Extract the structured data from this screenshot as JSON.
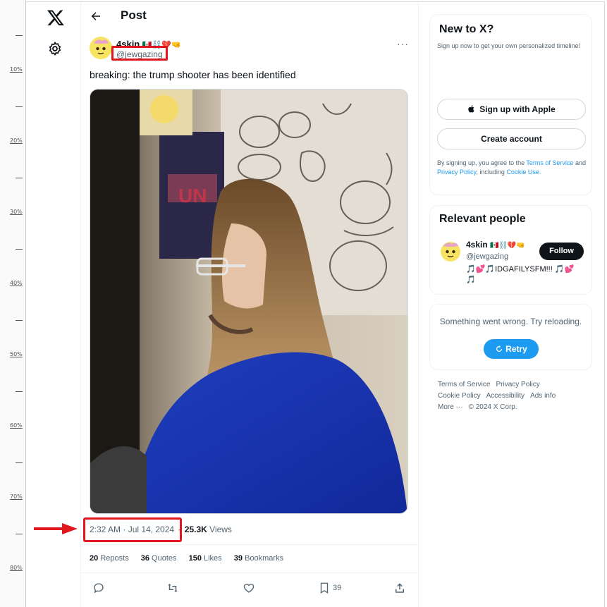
{
  "ruler": {
    "labels": [
      "10%",
      "20%",
      "30%",
      "40%",
      "50%",
      "60%",
      "70%",
      "80%"
    ]
  },
  "nav": {
    "logo_icon": "x-logo-icon",
    "settings_icon": "gear-icon"
  },
  "header": {
    "title": "Post",
    "back_icon": "arrow-left-icon"
  },
  "post": {
    "author_name": "4skin",
    "author_emojis": "🇲🇽⛓️💔🤜",
    "handle": "@jewgazing",
    "text": "breaking: the trump shooter has been identified",
    "timestamp": "2:32 AM · Jul 14, 2024",
    "views_count": "25.3K",
    "views_label": "Views",
    "stats": {
      "reposts_count": "20",
      "reposts_label": "Reposts",
      "quotes_count": "36",
      "quotes_label": "Quotes",
      "likes_count": "150",
      "likes_label": "Likes",
      "bookmarks_count": "39",
      "bookmarks_label": "Bookmarks"
    },
    "actions": {
      "bookmark_count": "39"
    }
  },
  "sidebar": {
    "signup": {
      "title": "New to X?",
      "subtitle": "Sign up now to get your own personalized timeline!",
      "apple_button": "Sign up with Apple",
      "create_button": "Create account",
      "terms_prefix": "By signing up, you agree to the ",
      "terms_link": "Terms of Service",
      "terms_and": " and ",
      "privacy_link": "Privacy Policy",
      "terms_including": ", including ",
      "cookie_link": "Cookie Use",
      "terms_end": "."
    },
    "relevant": {
      "title": "Relevant people",
      "name": "4skin",
      "handle": "@jewgazing",
      "follow_button": "Follow",
      "bio": "🎵💕🎵IDGAFILYSFM!!! 🎵💕🎵"
    },
    "error": {
      "message": "Something went wrong. Try reloading.",
      "retry_button": "Retry"
    },
    "footer": {
      "links": [
        "Terms of Service",
        "Privacy Policy",
        "Cookie Policy",
        "Accessibility",
        "Ads info",
        "More ···",
        "© 2024 X Corp."
      ]
    }
  },
  "colors": {
    "accent": "#1d9bf0",
    "annotation_red": "#e0171f",
    "text": "#0f1419",
    "muted": "#536471"
  }
}
